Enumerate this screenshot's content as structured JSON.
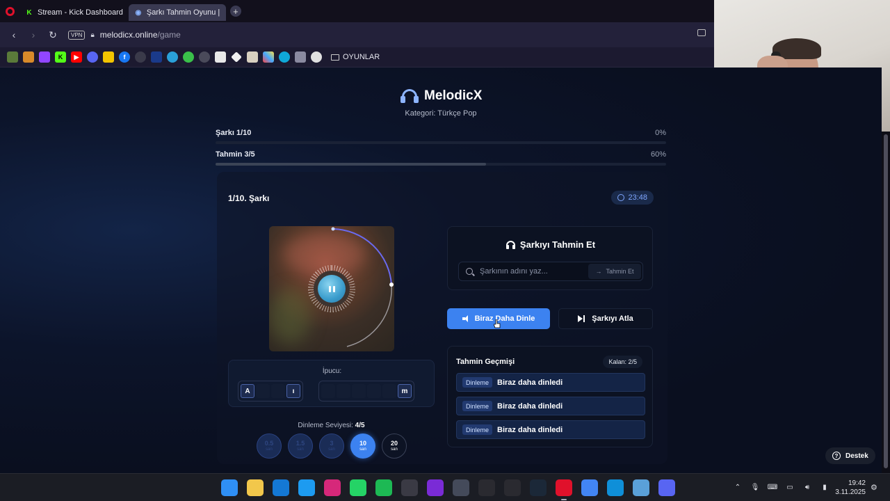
{
  "browser": {
    "tabs": [
      {
        "label": "Stream - Kick Dashboard",
        "icon": "kick-icon",
        "active": false
      },
      {
        "label": "Şarkı Tahmin Oyunu |",
        "icon": "game-icon",
        "active": true
      }
    ],
    "new_tab_label": "+",
    "address": {
      "vpn_label": "VPN",
      "domain": "melodicx.online",
      "path": "/game"
    },
    "bookmarks": {
      "icons": [
        "minecraft-icon",
        "pumpkin-icon",
        "twitch-icon",
        "kick-icon",
        "youtube-icon",
        "discord-icon",
        "yellow-icon",
        "facebook-icon",
        "openai-icon",
        "last-fm-icon",
        "water-icon",
        "green-icon",
        "pinterest-icon",
        "doc-icon",
        "diamond-icon",
        "menu-icon",
        "mosaic-icon",
        "edge-icon",
        "calendar-icon",
        "bird-icon"
      ],
      "folder_label": "OYUNLAR"
    }
  },
  "app": {
    "brand": "MelodicX",
    "category_text": "Kategori: Türkçe Pop",
    "song_progress": {
      "label": "Şarkı 1/10",
      "percent_text": "0%",
      "value": 0
    },
    "guess_progress": {
      "label": "Tahmin 3/5",
      "percent_text": "60%",
      "value": 60
    },
    "card": {
      "song_title": "1/10. Şarkı",
      "timer": "23:48"
    },
    "hint": {
      "label": "İpucu:",
      "word1": [
        "A",
        "",
        "",
        "ı"
      ],
      "word2": [
        "",
        "",
        "",
        "",
        "",
        "m"
      ]
    },
    "listen": {
      "label_prefix": "Dinleme Seviyesi: ",
      "level": "4/5",
      "levels": [
        {
          "value": "0.5",
          "unit": "san",
          "state": "used"
        },
        {
          "value": "1.5",
          "unit": "san",
          "state": "used"
        },
        {
          "value": "3",
          "unit": "san",
          "state": "used"
        },
        {
          "value": "10",
          "unit": "san",
          "state": "current"
        },
        {
          "value": "20",
          "unit": "san",
          "state": "next"
        }
      ]
    },
    "guess": {
      "title": "Şarkıyı Tahmin Et",
      "placeholder": "Şarkının adını yaz...",
      "submit_label": "Tahmin Et"
    },
    "buttons": {
      "more": "Biraz Daha Dinle",
      "skip": "Şarkıyı Atla"
    },
    "history": {
      "title": "Tahmin Geçmişi",
      "remaining": "Kalan: 2/5",
      "rows": [
        {
          "badge": "Dinleme",
          "text": "Biraz daha dinledi"
        },
        {
          "badge": "Dinleme",
          "text": "Biraz daha dinledi"
        },
        {
          "badge": "Dinleme",
          "text": "Biraz daha dinledi"
        }
      ]
    },
    "support_label": "Destek"
  },
  "taskbar": {
    "apps": [
      {
        "name": "windows-start-icon",
        "color": "#2f8ff5"
      },
      {
        "name": "file-explorer-icon",
        "color": "#f2c74b"
      },
      {
        "name": "outlook-icon",
        "color": "#1478d4"
      },
      {
        "name": "twitter-icon",
        "color": "#1d9bf0"
      },
      {
        "name": "instagram-icon",
        "color": "#d6287a"
      },
      {
        "name": "whatsapp-icon",
        "color": "#25d366"
      },
      {
        "name": "spotify-icon",
        "color": "#1db954"
      },
      {
        "name": "obs-icon",
        "color": "#3a3a44"
      },
      {
        "name": "purple-app-icon",
        "color": "#7a2bd6"
      },
      {
        "name": "ring-app-icon",
        "color": "#444a5a"
      },
      {
        "name": "gamesir-icon",
        "color": "#2a2a30"
      },
      {
        "name": "epic-games-icon",
        "color": "#2a2a30"
      },
      {
        "name": "steam-icon",
        "color": "#1b2838"
      },
      {
        "name": "opera-icon",
        "color": "#e0112b"
      },
      {
        "name": "chrome-icon",
        "color": "#4285f4"
      },
      {
        "name": "edge-icon",
        "color": "#0f8fd8"
      },
      {
        "name": "tool-icon",
        "color": "#5aa0d8"
      },
      {
        "name": "discord-icon",
        "color": "#5865f2"
      }
    ],
    "time": "19:42",
    "date": "3.11.2025"
  }
}
